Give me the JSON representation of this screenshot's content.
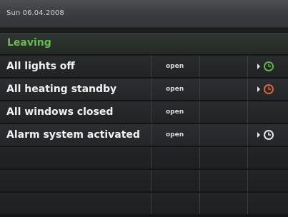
{
  "header": {
    "date": "Sun 06.04.2008"
  },
  "section": {
    "title": "Leaving"
  },
  "rows": [
    {
      "label": "All lights off",
      "state": "open",
      "timer": true,
      "timer_color": "#5ab840"
    },
    {
      "label": "All heating standby",
      "state": "open",
      "timer": true,
      "timer_color": "#e0603a"
    },
    {
      "label": "All windows closed",
      "state": "open",
      "timer": false
    },
    {
      "label": "Alarm system activated",
      "state": "open",
      "timer": true,
      "timer_color": "#e8e8e8"
    }
  ],
  "icons": {
    "timer": "clock-icon",
    "expand": "play-arrow-icon"
  }
}
